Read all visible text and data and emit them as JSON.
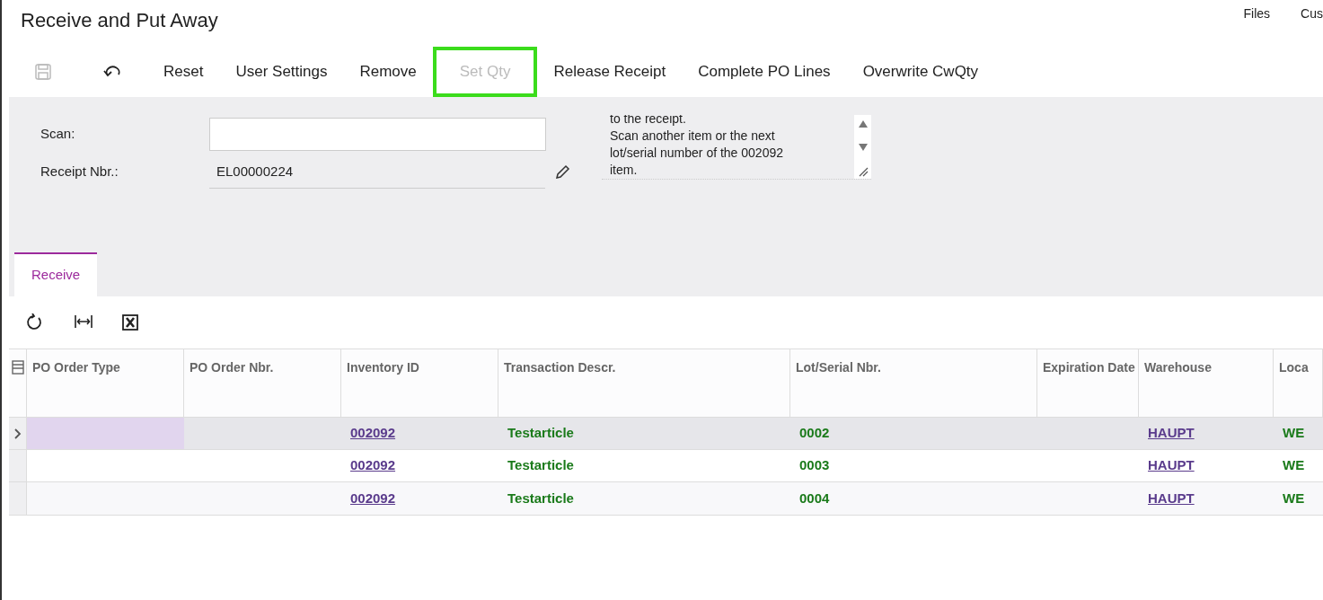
{
  "window": {
    "title": "Receive and Put Away"
  },
  "top_links": [
    "Files",
    "Cus"
  ],
  "toolbar": [
    {
      "kind": "save",
      "disabled": true,
      "highlighted": false
    },
    {
      "kind": "undo",
      "disabled": false,
      "highlighted": false
    },
    {
      "kind": "text",
      "label": "Reset",
      "disabled": false,
      "highlighted": false
    },
    {
      "kind": "text",
      "label": "User Settings",
      "disabled": false,
      "highlighted": false
    },
    {
      "kind": "text",
      "label": "Remove",
      "disabled": false,
      "highlighted": false
    },
    {
      "kind": "text",
      "label": "Set Qty",
      "disabled": true,
      "highlighted": true
    },
    {
      "kind": "text",
      "label": "Release Receipt",
      "disabled": false,
      "highlighted": false
    },
    {
      "kind": "text",
      "label": "Complete PO Lines",
      "disabled": false,
      "highlighted": false
    },
    {
      "kind": "text",
      "label": "Overwrite CwQty",
      "disabled": false,
      "highlighted": false
    }
  ],
  "form": {
    "scan": {
      "label": "Scan:"
    },
    "receipt_nbr": {
      "label": "Receipt Nbr.:",
      "value": "EL00000224"
    },
    "message": [
      "to the receipt.",
      "Scan another item or the next",
      "lot/serial number of the 002092",
      "item."
    ]
  },
  "tabs": [
    {
      "label": "Receive",
      "selected": true
    }
  ],
  "table": {
    "columns": [
      "PO Order Type",
      "PO Order Nbr.",
      "Inventory ID",
      "Transaction Descr.",
      "Lot/Serial Nbr.",
      "Expiration Date",
      "Warehouse",
      "Loca"
    ],
    "rows": [
      {
        "selected": true,
        "cells": [
          "",
          "",
          "002092",
          "Testarticle",
          "0002",
          "",
          "HAUPT",
          "WE"
        ]
      },
      {
        "selected": false,
        "cells": [
          "",
          "",
          "002092",
          "Testarticle",
          "0003",
          "",
          "HAUPT",
          "WE"
        ]
      },
      {
        "selected": false,
        "cells": [
          "",
          "",
          "002092",
          "Testarticle",
          "0004",
          "",
          "HAUPT",
          "WE"
        ]
      }
    ]
  }
}
